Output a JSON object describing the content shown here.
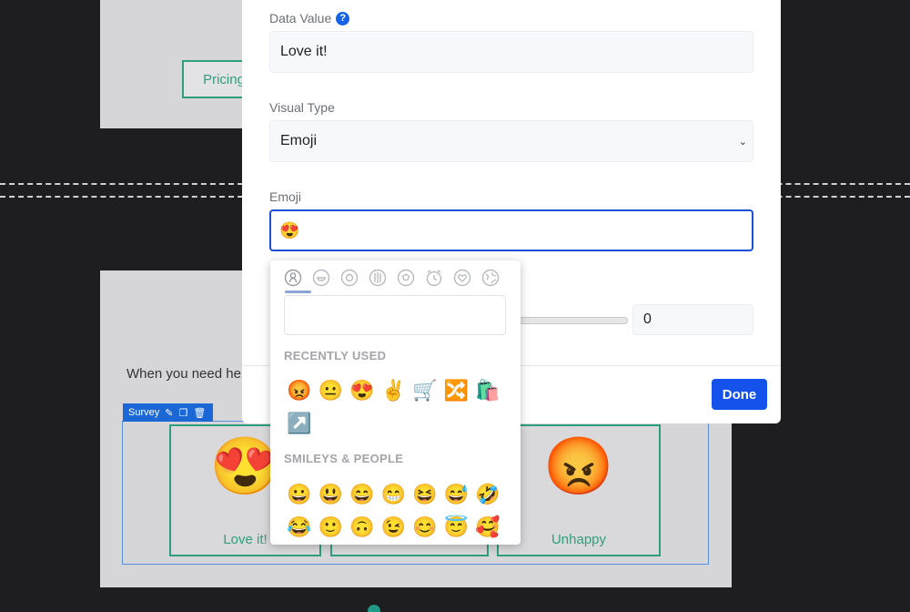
{
  "background": {
    "pricing_label": "Pricing",
    "need_help_text": "When you need he",
    "survey_tag_label": "Survey",
    "cards": [
      {
        "emoji": "😍",
        "label": "Love it!"
      },
      {
        "emoji": "",
        "label": ""
      },
      {
        "emoji": "😡",
        "label": "Unhappy"
      }
    ]
  },
  "modal": {
    "data_value_label": "Data Value",
    "help_glyph": "?",
    "data_value": "Love it!",
    "visual_type_label": "Visual Type",
    "visual_type_value": "Emoji",
    "emoji_label": "Emoji",
    "emoji_value": "😍",
    "number_value": "0",
    "done_label": "Done"
  },
  "picker": {
    "categories": [
      "person-icon",
      "food-icon",
      "activity-icon",
      "travel-icon",
      "ball-icon",
      "clock-icon",
      "heart-icon",
      "globe-icon"
    ],
    "recently_used_heading": "RECENTLY USED",
    "recent": [
      "😡",
      "😐",
      "😍",
      "✌️",
      "🛒",
      "🔀",
      "🛍️",
      "↗️"
    ],
    "smileys_heading": "SMILEYS & PEOPLE",
    "smileys": [
      "😀",
      "😃",
      "😄",
      "😁",
      "😆",
      "😅",
      "🤣",
      "😂",
      "🙂",
      "🙃",
      "😉",
      "😊",
      "😇",
      "🥰"
    ]
  },
  "colors": {
    "accent": "#1552ec",
    "green": "#2f9e7e",
    "active_border": "#1c4fd6"
  }
}
